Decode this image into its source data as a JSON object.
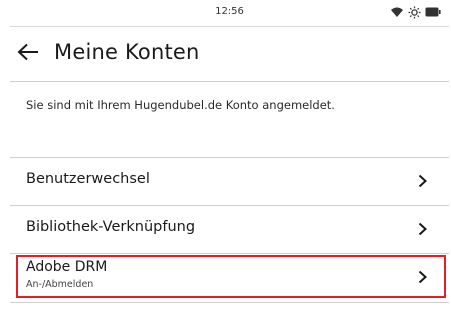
{
  "status_bar": {
    "time": "12:56",
    "icons": [
      "wifi-icon",
      "brightness-icon",
      "battery-icon"
    ]
  },
  "header": {
    "back_icon": "arrow-left-icon",
    "title": "Meine Konten"
  },
  "info": {
    "text": "Sie sind mit Ihrem Hugendubel.de Konto angemeldet."
  },
  "menu": {
    "items": [
      {
        "label": "Benutzerwechsel",
        "icon": "chevron-right-icon"
      },
      {
        "label": "Bibliothek-Verknüpfung",
        "icon": "chevron-right-icon"
      },
      {
        "label": "Adobe DRM",
        "sublabel": "An-/Abmelden",
        "icon": "chevron-right-icon",
        "highlighted": true
      }
    ]
  },
  "colors": {
    "highlight": "#e01f2a",
    "divider": "#cfcfcf",
    "text": "#1a1a1a"
  }
}
